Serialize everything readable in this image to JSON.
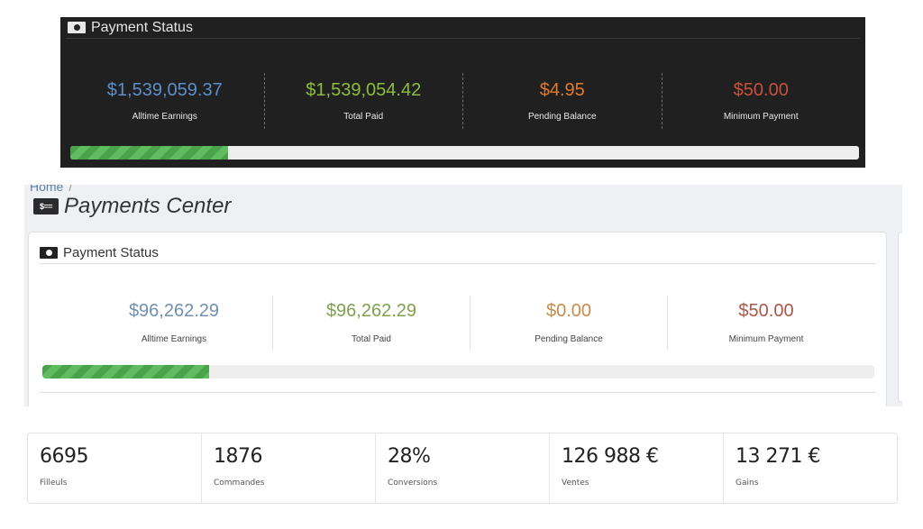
{
  "dark_panel": {
    "title": "Payment Status",
    "header_icon": "money-bill-icon",
    "stats": [
      {
        "value": "$1,539,059.37",
        "label": "Alltime Earnings",
        "color": "#5b8fc9"
      },
      {
        "value": "$1,539,054.42",
        "label": "Total Paid",
        "color": "#8fbc3f"
      },
      {
        "value": "$4.95",
        "label": "Pending Balance",
        "color": "#e07a2c"
      },
      {
        "value": "$50.00",
        "label": "Minimum Payment",
        "color": "#c8503a"
      }
    ],
    "progress_fraction": 0.2
  },
  "payments_center": {
    "breadcrumb_home": "Home",
    "breadcrumb_sep": "/",
    "title": "Payments Center",
    "title_icon_text": "$==",
    "card": {
      "title": "Payment Status",
      "header_icon": "money-bill-icon",
      "stats": [
        {
          "value": "$96,262.29",
          "label": "Alltime Earnings",
          "color": "#6f8fb3"
        },
        {
          "value": "$96,262.29",
          "label": "Total Paid",
          "color": "#7fa14e"
        },
        {
          "value": "$0.00",
          "label": "Pending Balance",
          "color": "#c98a4a"
        },
        {
          "value": "$50.00",
          "label": "Minimum Payment",
          "color": "#a8574a"
        }
      ],
      "progress_fraction": 0.2
    }
  },
  "fr_stats": [
    {
      "value": "6695",
      "label": "Filleuls"
    },
    {
      "value": "1876",
      "label": "Commandes"
    },
    {
      "value": "28%",
      "label": "Conversions"
    },
    {
      "value": "126 988 €",
      "label": "Ventes"
    },
    {
      "value": "13 271 €",
      "label": "Gains"
    }
  ]
}
